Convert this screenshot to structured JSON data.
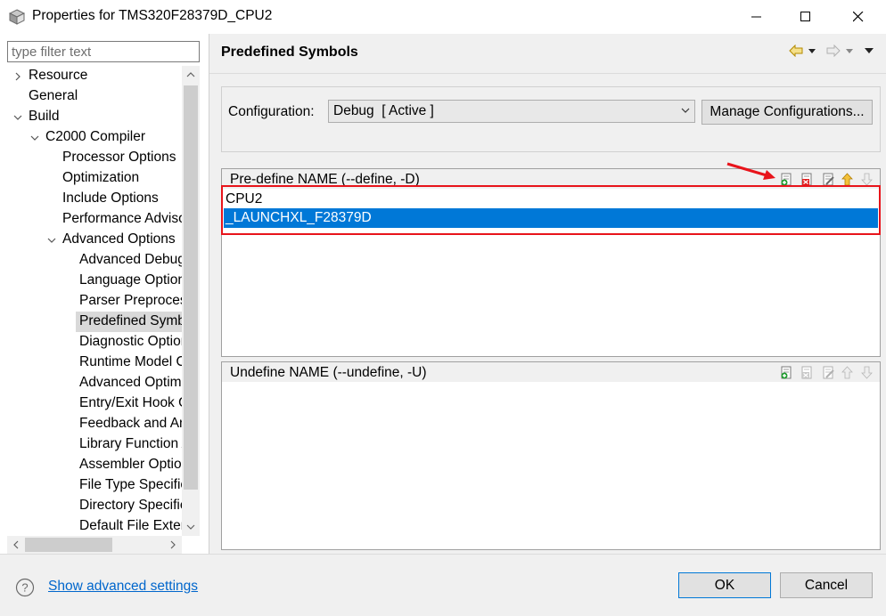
{
  "window": {
    "title": "Properties for TMS320F28379D_CPU2",
    "icons": [
      "app-cube-icon",
      "minimize-icon",
      "maximize-icon",
      "close-icon"
    ]
  },
  "filter": {
    "placeholder": "type filter text",
    "value": ""
  },
  "tree": {
    "items": [
      {
        "label": "Resource",
        "twisty": "collapsed"
      },
      {
        "label": "General",
        "twisty": "none"
      },
      {
        "label": "Build",
        "twisty": "expanded"
      },
      {
        "label": "C2000 Compiler",
        "twisty": "expanded"
      },
      {
        "label": "Processor Options",
        "twisty": "none"
      },
      {
        "label": "Optimization",
        "twisty": "none"
      },
      {
        "label": "Include Options",
        "twisty": "none"
      },
      {
        "label": "Performance Advisor",
        "twisty": "none"
      },
      {
        "label": "Advanced Options",
        "twisty": "expanded"
      },
      {
        "label": "Advanced Debug Options",
        "twisty": "none"
      },
      {
        "label": "Language Options",
        "twisty": "none"
      },
      {
        "label": "Parser Preprocessing Options",
        "twisty": "none"
      },
      {
        "label": "Predefined Symbols",
        "twisty": "none",
        "selected": true
      },
      {
        "label": "Diagnostic Options",
        "twisty": "none"
      },
      {
        "label": "Runtime Model Options",
        "twisty": "none"
      },
      {
        "label": "Advanced Optimizations",
        "twisty": "none"
      },
      {
        "label": "Entry/Exit Hook Options",
        "twisty": "none"
      },
      {
        "label": "Feedback and Analysis Options",
        "twisty": "none"
      },
      {
        "label": "Library Function Assumptions",
        "twisty": "none"
      },
      {
        "label": "Assembler Options",
        "twisty": "none"
      },
      {
        "label": "File Type Specifier",
        "twisty": "none"
      },
      {
        "label": "Directory Specifier",
        "twisty": "none"
      },
      {
        "label": "Default File Extensions",
        "twisty": "none"
      }
    ]
  },
  "page": {
    "title": "Predefined Symbols",
    "nav_icons": [
      "back-arrow-icon",
      "forward-arrow-icon",
      "view-menu-icon"
    ]
  },
  "configuration": {
    "label": "Configuration:",
    "selected": "Debug  [ Active ]",
    "manage_label": "Manage Configurations..."
  },
  "predefine": {
    "title": "Pre-define NAME (--define, -D)",
    "rows": [
      "CPU2",
      "_LAUNCHXL_F28379D"
    ],
    "selected_index": 1,
    "tools": [
      "add-icon",
      "delete-icon",
      "edit-icon",
      "move-up-icon",
      "move-down-icon"
    ]
  },
  "undefine": {
    "title": "Undefine NAME (--undefine, -U)",
    "rows": [],
    "tools": [
      "add-icon",
      "delete-icon",
      "edit-icon",
      "move-up-icon",
      "move-down-icon"
    ]
  },
  "annotation": {
    "highlight_color": "#e8141b",
    "arrow_color": "#e8141b"
  },
  "footer": {
    "advanced_link": "Show advanced settings",
    "ok_label": "OK",
    "cancel_label": "Cancel"
  },
  "colors": {
    "selection": "#0078d7",
    "link": "#0066cc"
  }
}
